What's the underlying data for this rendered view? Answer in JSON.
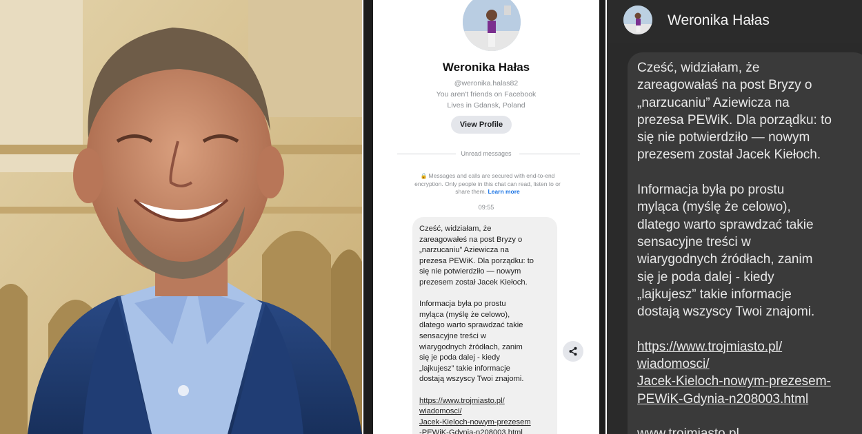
{
  "colors": {
    "messenger_link": "#1b74e4",
    "light_bubble": "#f0f0f0",
    "dark_bubble": "#3a3a3a",
    "dark_background": "#2a2a2a"
  },
  "profile": {
    "name": "Weronika Hałas",
    "handle": "@weronika.halas82",
    "friends_status": "You aren't friends on Facebook",
    "location": "Lives in Gdansk, Poland",
    "view_profile_label": "View Profile"
  },
  "chat": {
    "unread_label": "Unread messages",
    "encryption_notice": "Messages and calls are secured with end-to-end encryption. Only people in this chat can read, listen to or share them.",
    "learn_more": "Learn more",
    "time": "09:55",
    "lock_icon": "lock-icon",
    "share_icon": "share-icon"
  },
  "light_message": {
    "p1": [
      "Cześć, widziałam, że",
      "zareagowałeś na post Bryzy o",
      "„narzucaniu” Aziewicza na",
      "prezesa PEWiK. Dla porządku: to",
      "się nie potwierdziło — nowym",
      "prezesem został Jacek Kiełoch."
    ],
    "p2": [
      "Informacja była po prostu",
      "myląca (myślę że celowo),",
      "dlatego warto sprawdzać takie",
      "sensacyjne treści w",
      "wiarygodnych źródłach, zanim",
      "się je poda dalej - kiedy",
      "„lajkujesz” takie informacje",
      "dostają wszyscy Twoi znajomi."
    ],
    "link": [
      "https://www.trojmiasto.pl/",
      "wiadomosci/",
      "Jacek-Kieloch-nowym-prezesem",
      "-PEWiK-Gdynia-n208003.html"
    ]
  },
  "dark_message": {
    "p1": [
      "Cześć, widziałam, że",
      "zareagowałaś na post Bryzy o",
      "„narzucaniu” Aziewicza na",
      "prezesa PEWiK. Dla porządku: to",
      "się nie potwierdziło — nowym",
      "prezesem został Jacek Kiełoch."
    ],
    "p2": [
      "Informacja była po prostu",
      "myląca (myślę że celowo),",
      "dlatego warto sprawdzać takie",
      "sensacyjne treści w",
      "wiarygodnych źródłach, zanim",
      "się je poda dalej - kiedy",
      "„lajkujesz” takie informacje",
      "dostają wszyscy Twoi znajomi."
    ],
    "link": [
      "https://www.trojmiasto.pl/",
      "wiadomosci/",
      "Jacek-Kieloch-nowym-prezesem-",
      "PEWiK-Gdynia-n208003.html",
      "www.trojmiasto.pl"
    ]
  }
}
